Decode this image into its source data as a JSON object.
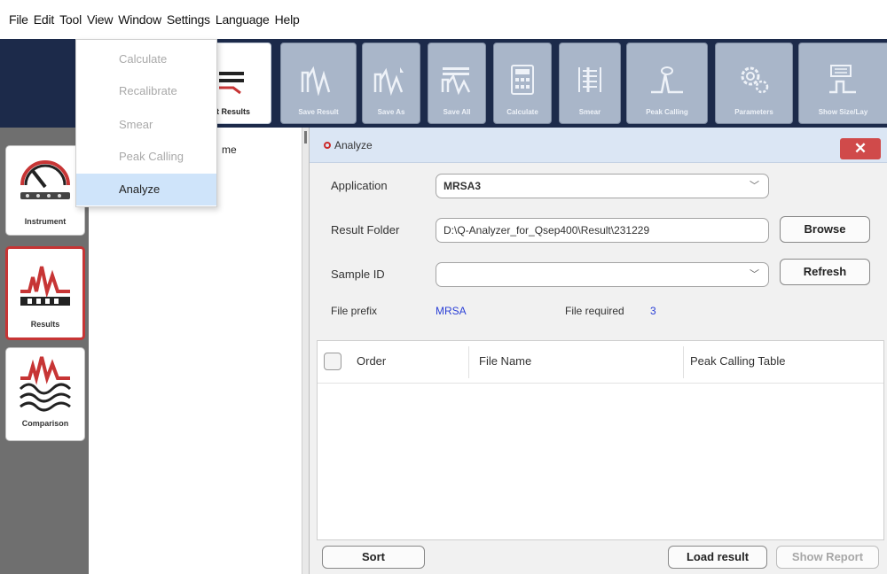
{
  "menubar": {
    "items": [
      "File",
      "Edit",
      "Tool",
      "View",
      "Window",
      "Settings",
      "Language",
      "Help"
    ]
  },
  "tool_menu": {
    "items": [
      {
        "label": "Calculate",
        "enabled": false
      },
      {
        "label": "Recalibrate",
        "enabled": false
      },
      {
        "label": "Smear",
        "enabled": false
      },
      {
        "label": "Peak Calling",
        "enabled": false
      },
      {
        "label": "Analyze",
        "enabled": true,
        "selected": true
      }
    ]
  },
  "toolbar": {
    "partial_label": "t Results",
    "buttons": [
      {
        "label": "Save Result",
        "icon": "save-result-icon"
      },
      {
        "label": "Save As",
        "icon": "save-as-icon"
      },
      {
        "label": "Save All",
        "icon": "save-all-icon"
      },
      {
        "label": "Calculate",
        "icon": "calculator-icon"
      },
      {
        "label": "Smear",
        "icon": "smear-icon"
      },
      {
        "label": "Peak Calling",
        "icon": "peak-calling-icon"
      },
      {
        "label": "Parameters",
        "icon": "gears-icon"
      },
      {
        "label": "Show Size/Lay",
        "icon": "size-ladder-icon"
      }
    ]
  },
  "left_rail": {
    "items": [
      {
        "label": "Instrument",
        "icon": "gauge-icon"
      },
      {
        "label": "Results",
        "icon": "electropherogram-icon",
        "active": true
      },
      {
        "label": "Comparison",
        "icon": "comparison-icon"
      }
    ]
  },
  "results_panel": {
    "header_fragment": "me"
  },
  "dialog": {
    "title": "Analyze",
    "application_label": "Application",
    "application_value": "MRSA3",
    "result_folder_label": "Result Folder",
    "result_folder_value": "D:\\Q-Analyzer_for_Qsep400\\Result\\231229",
    "browse_label": "Browse",
    "sample_id_label": "Sample ID",
    "sample_id_value": "",
    "refresh_label": "Refresh",
    "file_prefix_label": "File prefix",
    "file_prefix_value": "MRSA",
    "file_required_label": "File required",
    "file_required_value": "3",
    "table": {
      "columns": [
        "Order",
        "File Name",
        "Peak Calling Table"
      ],
      "rows": []
    },
    "sort_label": "Sort",
    "load_result_label": "Load result",
    "show_report_label": "Show Report"
  },
  "colors": {
    "toolbar_bg": "#1c2a4a",
    "accent_red": "#cc2b2b",
    "link_blue": "#2a3fd6",
    "selected_bg": "#cfe4fa"
  }
}
